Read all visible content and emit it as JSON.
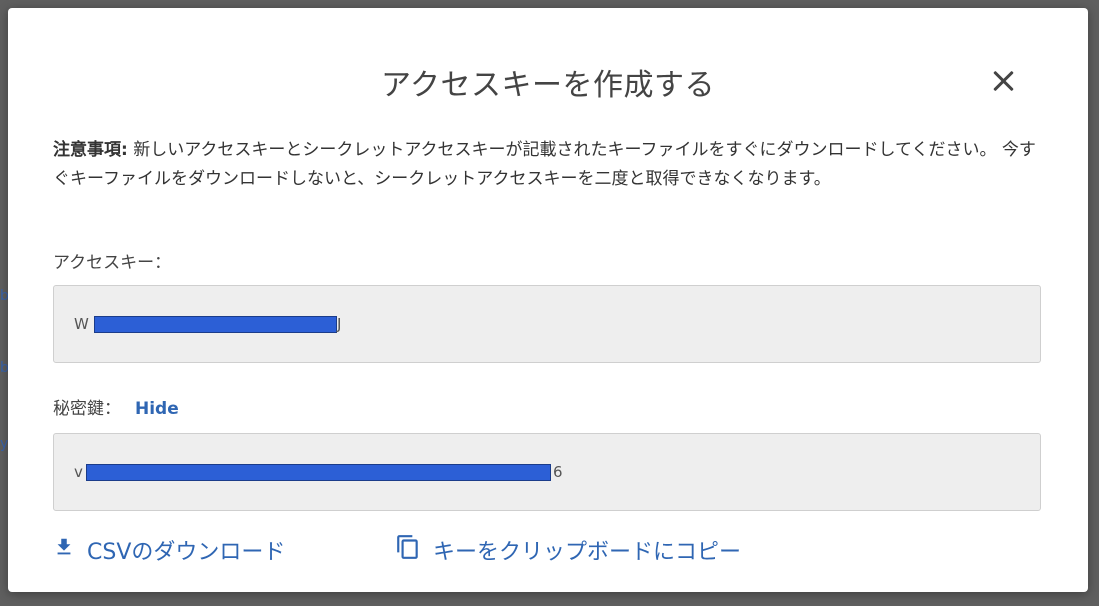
{
  "background": {
    "marks": [
      "b",
      "b",
      "y"
    ]
  },
  "dialog": {
    "title": "アクセスキーを作成する",
    "notice_bold": "注意事項:",
    "notice_text": " 新しいアクセスキーとシークレットアクセスキーが記載されたキーファイルをすぐにダウンロードしてください。 今すぐキーファイルをダウンロードしないと、シークレットアクセスキーを二度と取得できなくなります。",
    "access_key_label": "アクセスキー：",
    "access_key_prefix": "W",
    "access_key_suffix": "J",
    "secret_key_label": "秘密鍵：",
    "hide_link": "Hide",
    "secret_key_prefix": "v",
    "secret_key_suffix": "6",
    "download_csv": "CSVのダウンロード",
    "copy_to_clipboard": "キーをクリップボードにコピー"
  },
  "colors": {
    "link": "#2f66b3",
    "redaction": "#2c5fd6",
    "field_bg": "#eeeeee"
  },
  "icons": {
    "close": "close-icon",
    "download": "download-icon",
    "copy": "copy-icon"
  }
}
